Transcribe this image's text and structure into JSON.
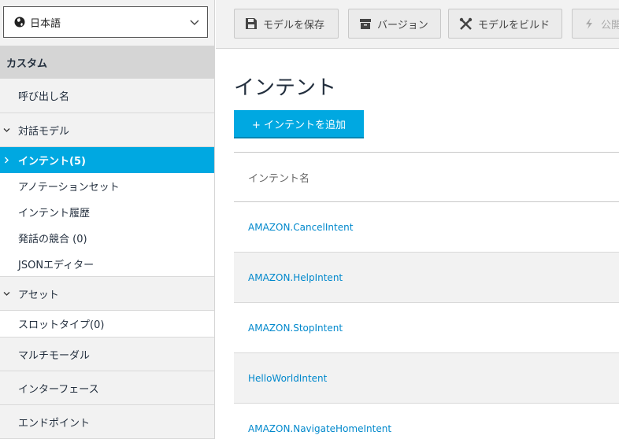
{
  "language": {
    "selected": "日本語"
  },
  "sidebar": {
    "header": "カスタム",
    "invocation": "呼び出し名",
    "interaction_model": "対話モデル",
    "intents": "インテント(5)",
    "annotation_sets": "アノテーションセット",
    "intent_history": "インテント履歴",
    "utterance_conflicts": "発話の競合 (0)",
    "json_editor": "JSONエディター",
    "assets": "アセット",
    "slot_types": "スロットタイプ(0)",
    "multimodal": "マルチモーダル",
    "interfaces": "インターフェース",
    "endpoint": "エンドポイント"
  },
  "toolbar": {
    "save": "モデルを保存",
    "versions": "バージョン",
    "build": "モデルをビルド",
    "publish": "公開"
  },
  "main": {
    "title": "インテント",
    "add_button": "+ インテントを追加",
    "column_header": "インテント名",
    "intents": [
      "AMAZON.CancelIntent",
      "AMAZON.HelpIntent",
      "AMAZON.StopIntent",
      "HelloWorldIntent",
      "AMAZON.NavigateHomeIntent"
    ]
  },
  "colors": {
    "accent": "#00a8e1",
    "link": "#0088cc",
    "sidebar_header_bg": "#d5d5d5"
  }
}
